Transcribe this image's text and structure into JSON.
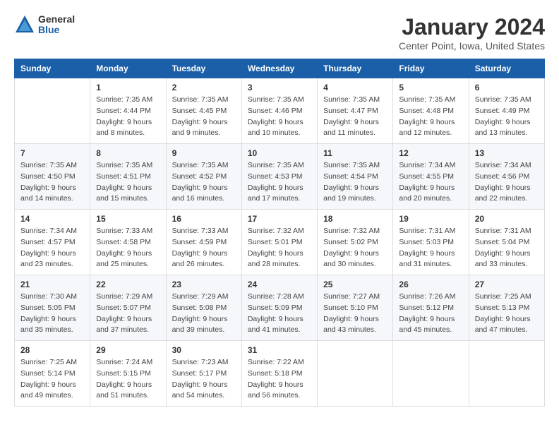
{
  "logo": {
    "general": "General",
    "blue": "Blue"
  },
  "title": {
    "month": "January 2024",
    "location": "Center Point, Iowa, United States"
  },
  "weekdays": [
    "Sunday",
    "Monday",
    "Tuesday",
    "Wednesday",
    "Thursday",
    "Friday",
    "Saturday"
  ],
  "weeks": [
    [
      {
        "day": "",
        "info": ""
      },
      {
        "day": "1",
        "info": "Sunrise: 7:35 AM\nSunset: 4:44 PM\nDaylight: 9 hours\nand 8 minutes."
      },
      {
        "day": "2",
        "info": "Sunrise: 7:35 AM\nSunset: 4:45 PM\nDaylight: 9 hours\nand 9 minutes."
      },
      {
        "day": "3",
        "info": "Sunrise: 7:35 AM\nSunset: 4:46 PM\nDaylight: 9 hours\nand 10 minutes."
      },
      {
        "day": "4",
        "info": "Sunrise: 7:35 AM\nSunset: 4:47 PM\nDaylight: 9 hours\nand 11 minutes."
      },
      {
        "day": "5",
        "info": "Sunrise: 7:35 AM\nSunset: 4:48 PM\nDaylight: 9 hours\nand 12 minutes."
      },
      {
        "day": "6",
        "info": "Sunrise: 7:35 AM\nSunset: 4:49 PM\nDaylight: 9 hours\nand 13 minutes."
      }
    ],
    [
      {
        "day": "7",
        "info": "Sunrise: 7:35 AM\nSunset: 4:50 PM\nDaylight: 9 hours\nand 14 minutes."
      },
      {
        "day": "8",
        "info": "Sunrise: 7:35 AM\nSunset: 4:51 PM\nDaylight: 9 hours\nand 15 minutes."
      },
      {
        "day": "9",
        "info": "Sunrise: 7:35 AM\nSunset: 4:52 PM\nDaylight: 9 hours\nand 16 minutes."
      },
      {
        "day": "10",
        "info": "Sunrise: 7:35 AM\nSunset: 4:53 PM\nDaylight: 9 hours\nand 17 minutes."
      },
      {
        "day": "11",
        "info": "Sunrise: 7:35 AM\nSunset: 4:54 PM\nDaylight: 9 hours\nand 19 minutes."
      },
      {
        "day": "12",
        "info": "Sunrise: 7:34 AM\nSunset: 4:55 PM\nDaylight: 9 hours\nand 20 minutes."
      },
      {
        "day": "13",
        "info": "Sunrise: 7:34 AM\nSunset: 4:56 PM\nDaylight: 9 hours\nand 22 minutes."
      }
    ],
    [
      {
        "day": "14",
        "info": "Sunrise: 7:34 AM\nSunset: 4:57 PM\nDaylight: 9 hours\nand 23 minutes."
      },
      {
        "day": "15",
        "info": "Sunrise: 7:33 AM\nSunset: 4:58 PM\nDaylight: 9 hours\nand 25 minutes."
      },
      {
        "day": "16",
        "info": "Sunrise: 7:33 AM\nSunset: 4:59 PM\nDaylight: 9 hours\nand 26 minutes."
      },
      {
        "day": "17",
        "info": "Sunrise: 7:32 AM\nSunset: 5:01 PM\nDaylight: 9 hours\nand 28 minutes."
      },
      {
        "day": "18",
        "info": "Sunrise: 7:32 AM\nSunset: 5:02 PM\nDaylight: 9 hours\nand 30 minutes."
      },
      {
        "day": "19",
        "info": "Sunrise: 7:31 AM\nSunset: 5:03 PM\nDaylight: 9 hours\nand 31 minutes."
      },
      {
        "day": "20",
        "info": "Sunrise: 7:31 AM\nSunset: 5:04 PM\nDaylight: 9 hours\nand 33 minutes."
      }
    ],
    [
      {
        "day": "21",
        "info": "Sunrise: 7:30 AM\nSunset: 5:05 PM\nDaylight: 9 hours\nand 35 minutes."
      },
      {
        "day": "22",
        "info": "Sunrise: 7:29 AM\nSunset: 5:07 PM\nDaylight: 9 hours\nand 37 minutes."
      },
      {
        "day": "23",
        "info": "Sunrise: 7:29 AM\nSunset: 5:08 PM\nDaylight: 9 hours\nand 39 minutes."
      },
      {
        "day": "24",
        "info": "Sunrise: 7:28 AM\nSunset: 5:09 PM\nDaylight: 9 hours\nand 41 minutes."
      },
      {
        "day": "25",
        "info": "Sunrise: 7:27 AM\nSunset: 5:10 PM\nDaylight: 9 hours\nand 43 minutes."
      },
      {
        "day": "26",
        "info": "Sunrise: 7:26 AM\nSunset: 5:12 PM\nDaylight: 9 hours\nand 45 minutes."
      },
      {
        "day": "27",
        "info": "Sunrise: 7:25 AM\nSunset: 5:13 PM\nDaylight: 9 hours\nand 47 minutes."
      }
    ],
    [
      {
        "day": "28",
        "info": "Sunrise: 7:25 AM\nSunset: 5:14 PM\nDaylight: 9 hours\nand 49 minutes."
      },
      {
        "day": "29",
        "info": "Sunrise: 7:24 AM\nSunset: 5:15 PM\nDaylight: 9 hours\nand 51 minutes."
      },
      {
        "day": "30",
        "info": "Sunrise: 7:23 AM\nSunset: 5:17 PM\nDaylight: 9 hours\nand 54 minutes."
      },
      {
        "day": "31",
        "info": "Sunrise: 7:22 AM\nSunset: 5:18 PM\nDaylight: 9 hours\nand 56 minutes."
      },
      {
        "day": "",
        "info": ""
      },
      {
        "day": "",
        "info": ""
      },
      {
        "day": "",
        "info": ""
      }
    ]
  ]
}
